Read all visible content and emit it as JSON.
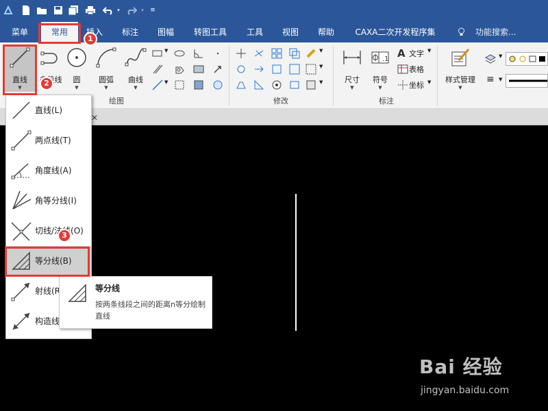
{
  "tabs": [
    "菜单",
    "常用",
    "插入",
    "标注",
    "图幅",
    "转图工具",
    "工具",
    "视图",
    "帮助",
    "CAXA二次开发程序集"
  ],
  "active_tab": "常用",
  "search_label": "功能搜索...",
  "ribbon": {
    "draw": {
      "line_label": "直线",
      "polyline_label": "多段线",
      "circle_label": "圆",
      "arc_label": "圆弧",
      "curve_label": "曲线",
      "group_label": "绘图"
    },
    "modify_group_label": "修改",
    "annotate": {
      "dimension_label": "尺寸",
      "symbol_label": "符号",
      "text_label": "文字",
      "table_label": "表格",
      "coordinate_label": "坐标",
      "group_label": "标注"
    },
    "style_manager_label": "样式管理"
  },
  "dropdown": {
    "items": [
      "直线(L)",
      "两点线(T)",
      "角度线(A)",
      "角等分线(I)",
      "切线/法线(O)",
      "等分线(B)",
      "射线(R)",
      "构造线"
    ]
  },
  "tooltip": {
    "title": "等分线",
    "description": "按两条线段之间的距离n等分绘制直线"
  },
  "annotations": [
    "1",
    "2",
    "3"
  ],
  "watermark": {
    "main": "Bai 经验",
    "url": "jingyan.baidu.com"
  },
  "colors": {
    "titlebar": "#2b579a",
    "ribbon": "#f3f3f3",
    "canvas": "#000000",
    "highlight": "#e53935"
  }
}
